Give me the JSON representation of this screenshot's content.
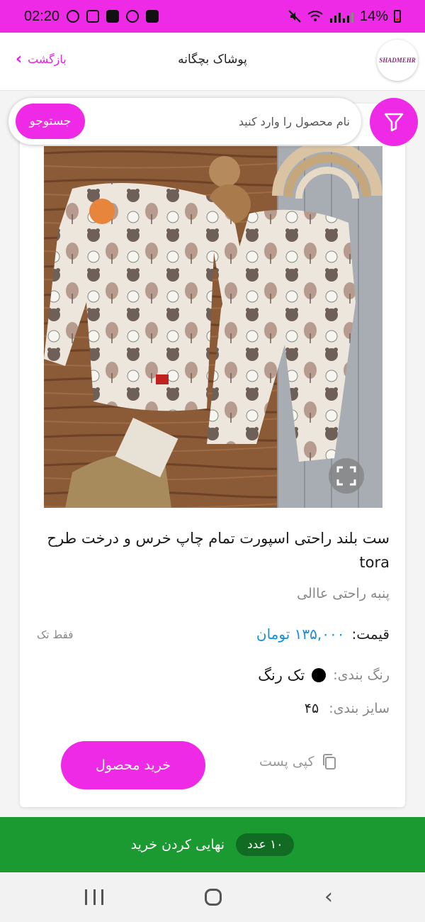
{
  "status_bar": {
    "time": "02:20",
    "battery": "14%",
    "icons": [
      "circle-notification-icon",
      "instagram-icon",
      "app-29-icon",
      "b-icon",
      "gallery-icon",
      "mute-icon",
      "wifi-icon",
      "signal-icon",
      "battery-icon"
    ]
  },
  "header": {
    "logo_text": "SHADMEHR",
    "title": "پوشاک بچگانه",
    "back_label": "بازگشت"
  },
  "search": {
    "placeholder": "نام محصول را وارد کنید",
    "button_label": "جستوجو"
  },
  "product": {
    "title": "ست بلند راحتی اسپورت تمام چاپ خرس و درخت طرح tora",
    "subtitle": "پنبه راحتی عاالی",
    "price_label": "قیمت:",
    "price_value": "۱۳۵,۰۰۰ تومان",
    "only_one": "فقط تک",
    "color_label": "رنگ بندی:",
    "color_value": "تک رنگ",
    "size_label": "سایز بندی:",
    "size_value": "۴۵",
    "buy_label": "خرید محصول",
    "copy_label": "کپی پست"
  },
  "checkout": {
    "label": "نهایی کردن خرید",
    "count": "۱۰ عدد"
  },
  "colors": {
    "accent": "#ee2ae6",
    "price": "#1a8fd6",
    "checkout": "#1a9a30"
  }
}
